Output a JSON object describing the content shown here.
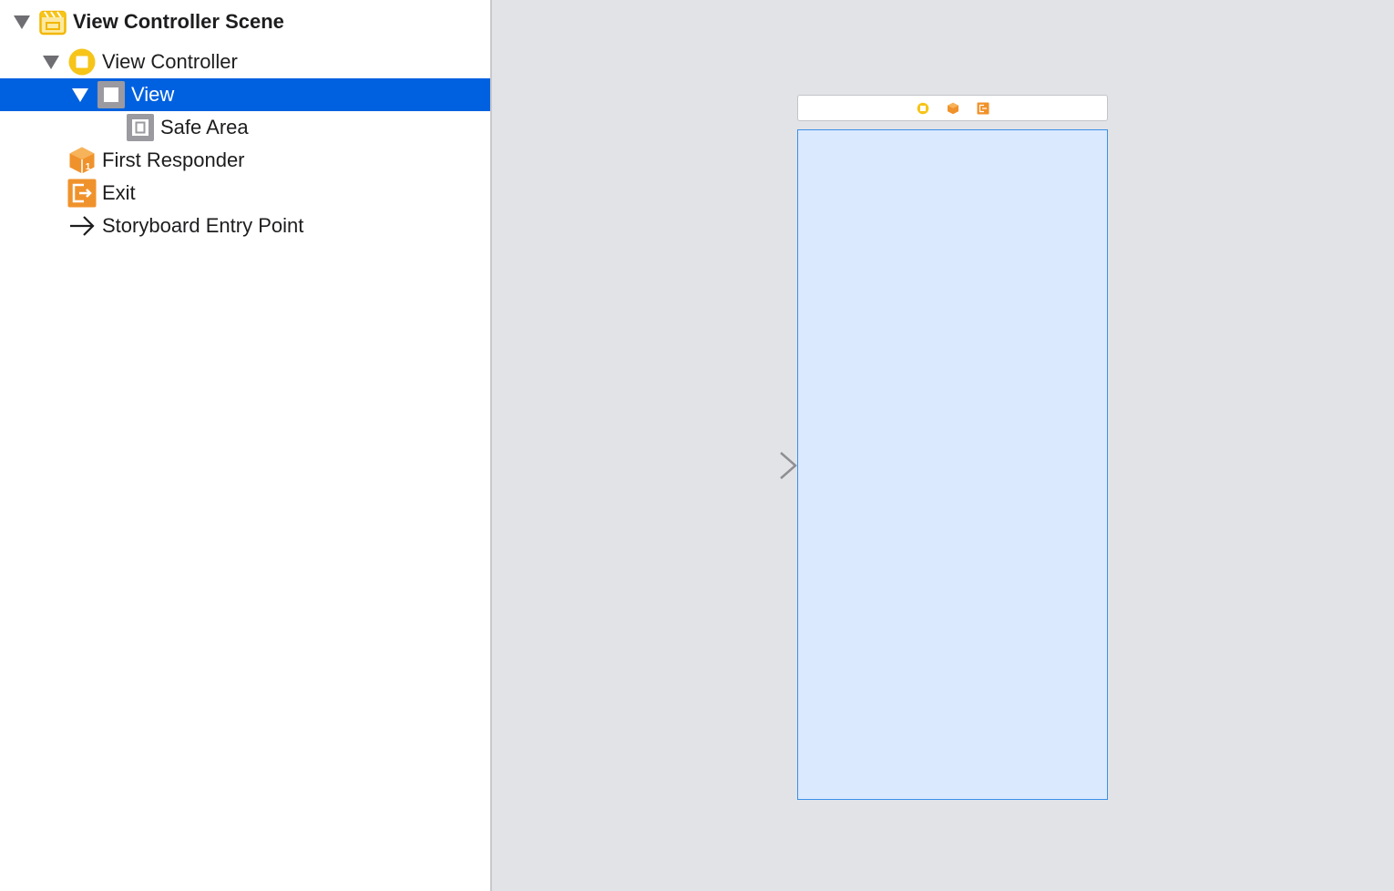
{
  "outline": {
    "items": [
      {
        "label": "View Controller Scene",
        "icon": "scene-icon",
        "expanded": true,
        "bold": true
      },
      {
        "label": "View Controller",
        "icon": "view-controller-icon",
        "expanded": true
      },
      {
        "label": "View",
        "icon": "view-icon",
        "expanded": true,
        "selected": true
      },
      {
        "label": "Safe Area",
        "icon": "safe-area-icon"
      },
      {
        "label": "First Responder",
        "icon": "first-responder-icon"
      },
      {
        "label": "Exit",
        "icon": "exit-icon"
      },
      {
        "label": "Storyboard Entry Point",
        "icon": "arrow-right-icon"
      }
    ]
  },
  "canvas": {
    "dock_icons": [
      "view-controller-icon",
      "first-responder-icon",
      "exit-icon"
    ],
    "has_entry_point_arrow": true
  },
  "colors": {
    "selection": "#0061e0",
    "canvas_background": "#e2e3e7",
    "view_fill": "#dae9fe",
    "view_border": "#3c8fe8",
    "scene_icon": "#f7c418",
    "responder_icon": "#f0922b"
  }
}
